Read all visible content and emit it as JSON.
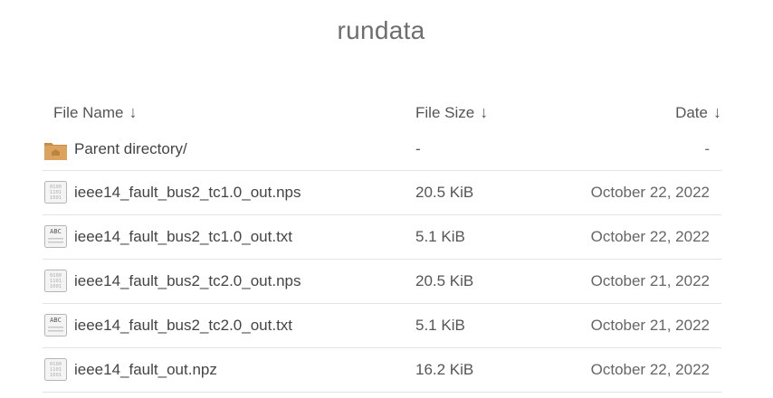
{
  "title": "rundata",
  "headers": {
    "name": "File Name",
    "size": "File Size",
    "date": "Date",
    "sort_arrow": "↓"
  },
  "parent": {
    "name": "Parent directory/",
    "size": "-",
    "date": "-",
    "icon": "folder-icon"
  },
  "files": [
    {
      "name": "ieee14_fault_bus2_tc1.0_out.nps",
      "size": "20.5 KiB",
      "date": "October 22, 2022",
      "icon": "binary-file-icon"
    },
    {
      "name": "ieee14_fault_bus2_tc1.0_out.txt",
      "size": "5.1 KiB",
      "date": "October 22, 2022",
      "icon": "text-file-icon"
    },
    {
      "name": "ieee14_fault_bus2_tc2.0_out.nps",
      "size": "20.5 KiB",
      "date": "October 21, 2022",
      "icon": "binary-file-icon"
    },
    {
      "name": "ieee14_fault_bus2_tc2.0_out.txt",
      "size": "5.1 KiB",
      "date": "October 21, 2022",
      "icon": "text-file-icon"
    },
    {
      "name": "ieee14_fault_out.npz",
      "size": "16.2 KiB",
      "date": "October 22, 2022",
      "icon": "binary-file-icon"
    }
  ],
  "colors": {
    "folder": "#d9a15f",
    "file_border": "#b5b5b5",
    "divider": "#e3e3e3"
  }
}
